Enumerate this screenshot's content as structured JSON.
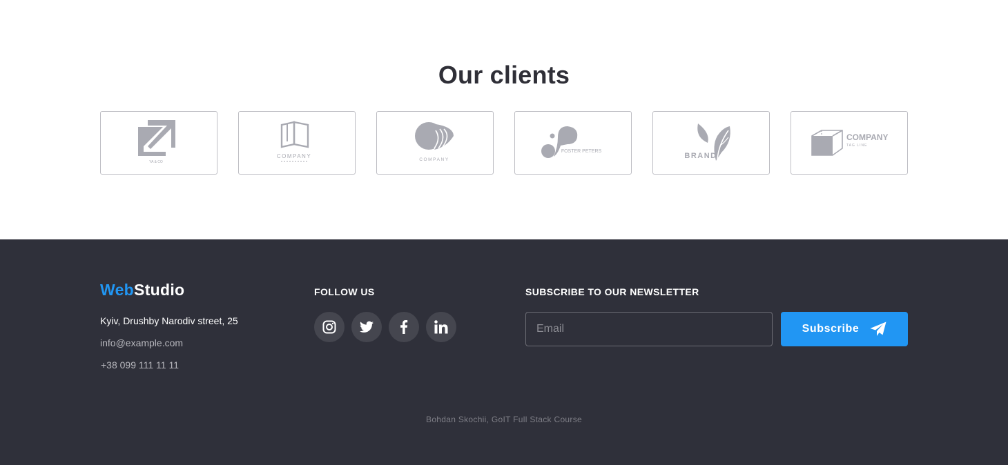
{
  "clients": {
    "title": "Our clients",
    "logos": [
      {
        "name": "ya-co",
        "caption": "YA & CO"
      },
      {
        "name": "company-book",
        "caption": "COMPANY"
      },
      {
        "name": "company-shell",
        "caption": "COMPANY"
      },
      {
        "name": "foster-peters",
        "caption": "FOSTER PETERS"
      },
      {
        "name": "brand-leaf",
        "caption": "BRAND"
      },
      {
        "name": "company-box",
        "caption": "COMPANY",
        "tagline": "TAG LINE"
      }
    ],
    "logo_color": "#a9aab2"
  },
  "footer": {
    "brand": {
      "part1": "Web",
      "part2": "Studio"
    },
    "address": "Kyiv, Drushby Narodiv street, 25",
    "email": "info@example.com",
    "phone": "+38 099 111 11 11",
    "follow_title": "FOLLOW US",
    "socials": [
      {
        "icon": "instagram-icon"
      },
      {
        "icon": "twitter-icon"
      },
      {
        "icon": "facebook-icon"
      },
      {
        "icon": "linkedin-icon"
      }
    ],
    "newsletter_title": "SUBSCRIBE TO OUR NEWSLETTER",
    "email_placeholder": "Email",
    "subscribe_label": "Subscribe",
    "copyright": "Bohdan Skochii, GoIT Full Stack Course"
  },
  "colors": {
    "accent": "#2196f3",
    "footer_bg": "#2f303a",
    "heading": "#2f2f37"
  }
}
